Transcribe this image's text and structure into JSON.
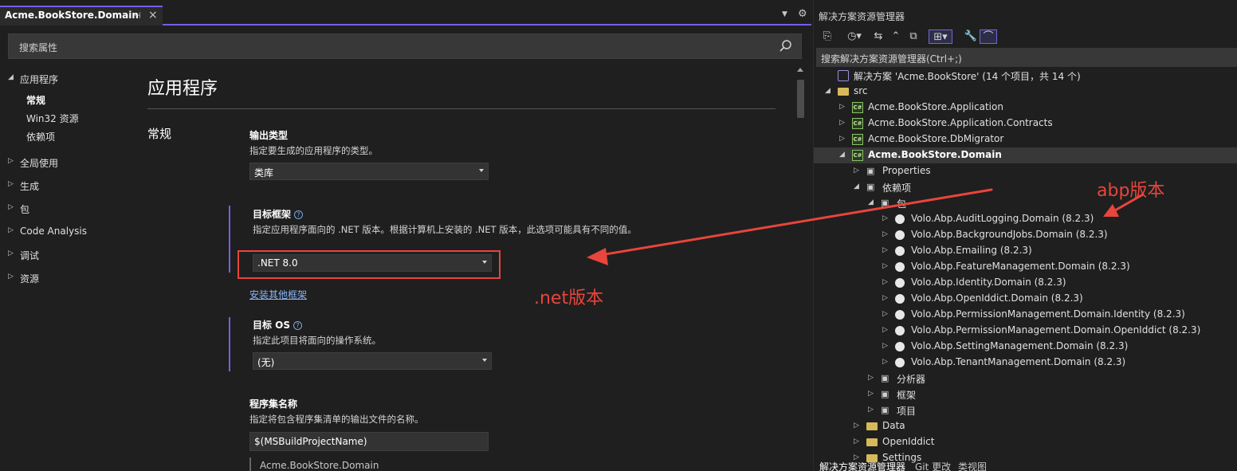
{
  "tab": {
    "title": "Acme.BookStore.Domain",
    "pin": "⊣",
    "close": "×"
  },
  "search": {
    "placeholder": "搜索属性"
  },
  "nav": {
    "items": [
      {
        "label": "应用程序",
        "expanded": true
      },
      {
        "label": "全局使用",
        "expanded": false
      },
      {
        "label": "生成",
        "expanded": false
      },
      {
        "label": "包",
        "expanded": false
      },
      {
        "label": "Code Analysis",
        "expanded": false
      },
      {
        "label": "调试",
        "expanded": false
      },
      {
        "label": "资源",
        "expanded": false
      }
    ],
    "sub_items": [
      "常规",
      "Win32 资源",
      "依赖项"
    ]
  },
  "content": {
    "title": "应用程序",
    "section": "常规",
    "output_type": {
      "label": "输出类型",
      "desc": "指定要生成的应用程序的类型。",
      "value": "类库"
    },
    "target_framework": {
      "label": "目标框架",
      "desc": "指定应用程序面向的 .NET 版本。根据计算机上安装的 .NET 版本，此选项可能具有不同的值。",
      "value": ".NET 8.0",
      "link": "安装其他框架"
    },
    "target_os": {
      "label": "目标 OS",
      "desc": "指定此项目将面向的操作系统。",
      "value": "(无)"
    },
    "assembly_name": {
      "label": "程序集名称",
      "desc": "指定将包含程序集清单的输出文件的名称。",
      "value": "$(MSBuildProjectName)",
      "preview": "Acme.BookStore.Domain"
    }
  },
  "solution_explorer": {
    "title": "解决方案资源管理器",
    "search_placeholder": "搜索解决方案资源管理器(Ctrl+;)",
    "rows": [
      {
        "label": "解决方案 'Acme.BookStore' (14 个项目，共 14 个)",
        "icon": "solution-icon",
        "arrow": ""
      },
      {
        "label": "src",
        "icon": "folder-icon",
        "arrow": "◢"
      },
      {
        "label": "Acme.BookStore.Application",
        "icon": "csharp-project-icon",
        "arrow": "▷"
      },
      {
        "label": "Acme.BookStore.Application.Contracts",
        "icon": "csharp-project-icon",
        "arrow": "▷"
      },
      {
        "label": "Acme.BookStore.DbMigrator",
        "icon": "csharp-project-icon",
        "arrow": "▷"
      },
      {
        "label": "Acme.BookStore.Domain",
        "icon": "csharp-project-icon",
        "arrow": "◢"
      },
      {
        "label": "Properties",
        "icon": "properties-icon",
        "arrow": "▷"
      },
      {
        "label": "依赖项",
        "icon": "dependencies-icon",
        "arrow": "◢"
      },
      {
        "label": "包",
        "icon": "packages-icon",
        "arrow": "◢"
      },
      {
        "label": "Volo.Abp.AuditLogging.Domain (8.2.3)",
        "icon": "nuget-package-icon",
        "arrow": "▷"
      },
      {
        "label": "Volo.Abp.BackgroundJobs.Domain (8.2.3)",
        "icon": "nuget-package-icon",
        "arrow": "▷"
      },
      {
        "label": "Volo.Abp.Emailing (8.2.3)",
        "icon": "nuget-package-icon",
        "arrow": "▷"
      },
      {
        "label": "Volo.Abp.FeatureManagement.Domain (8.2.3)",
        "icon": "nuget-package-icon",
        "arrow": "▷"
      },
      {
        "label": "Volo.Abp.Identity.Domain (8.2.3)",
        "icon": "nuget-package-icon",
        "arrow": "▷"
      },
      {
        "label": "Volo.Abp.OpenIddict.Domain (8.2.3)",
        "icon": "nuget-package-icon",
        "arrow": "▷"
      },
      {
        "label": "Volo.Abp.PermissionManagement.Domain.Identity (8.2.3)",
        "icon": "nuget-package-icon",
        "arrow": "▷"
      },
      {
        "label": "Volo.Abp.PermissionManagement.Domain.OpenIddict (8.2.3)",
        "icon": "nuget-package-icon",
        "arrow": "▷"
      },
      {
        "label": "Volo.Abp.SettingManagement.Domain (8.2.3)",
        "icon": "nuget-package-icon",
        "arrow": "▷"
      },
      {
        "label": "Volo.Abp.TenantManagement.Domain (8.2.3)",
        "icon": "nuget-package-icon",
        "arrow": "▷"
      },
      {
        "label": "分析器",
        "icon": "analyzers-icon",
        "arrow": "▷"
      },
      {
        "label": "框架",
        "icon": "frameworks-icon",
        "arrow": "▷"
      },
      {
        "label": "项目",
        "icon": "projects-icon",
        "arrow": "▷"
      },
      {
        "label": "Data",
        "icon": "folder-icon",
        "arrow": "▷"
      },
      {
        "label": "OpenIddict",
        "icon": "folder-icon",
        "arrow": "▷"
      },
      {
        "label": "Settings",
        "icon": "folder-icon",
        "arrow": "▷"
      }
    ],
    "bottom_tabs": [
      "解决方案资源管理器",
      "Git 更改",
      "类视图"
    ]
  },
  "annotations": {
    "net_label": ".net版本",
    "abp_label": "abp版本",
    "color": "#e8453c"
  },
  "colors": {
    "accent": "#7160e8",
    "link": "#8ab4f8",
    "annotation": "#e8453c"
  }
}
